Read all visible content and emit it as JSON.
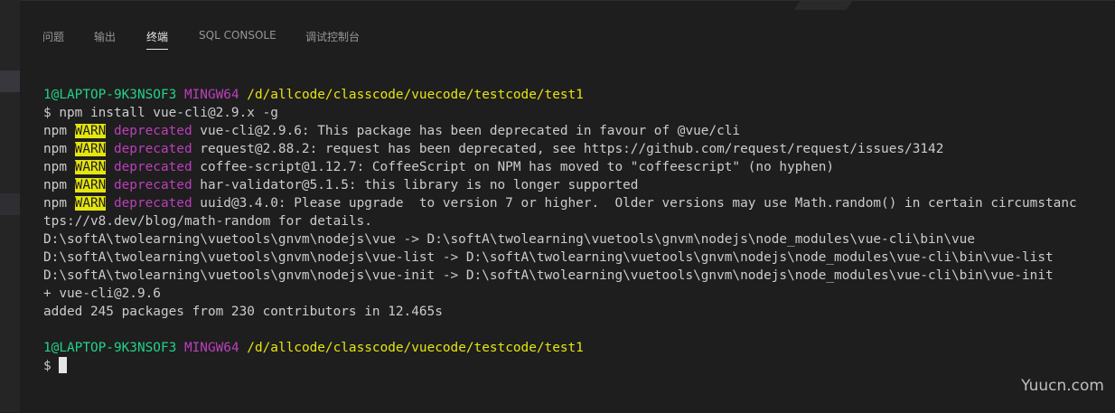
{
  "panel": {
    "tabs": [
      {
        "label": "问题",
        "active": false
      },
      {
        "label": "输出",
        "active": false
      },
      {
        "label": "终端",
        "active": true
      },
      {
        "label": "SQL CONSOLE",
        "active": false
      },
      {
        "label": "调试控制台",
        "active": false
      }
    ]
  },
  "terminal": {
    "prompt1": {
      "user": "1@LAPTOP-9K3NSOF3",
      "shell": "MINGW64",
      "path": "/d/allcode/classcode/vuecode/testcode/test1"
    },
    "command": "$ npm install vue-cli@2.9.x -g",
    "warnings": [
      {
        "prefix": "npm ",
        "level": "WARN",
        "kind": "deprecated",
        "message": " vue-cli@2.9.6: This package has been deprecated in favour of @vue/cli"
      },
      {
        "prefix": "npm ",
        "level": "WARN",
        "kind": "deprecated",
        "message": " request@2.88.2: request has been deprecated, see https://github.com/request/request/issues/3142"
      },
      {
        "prefix": "npm ",
        "level": "WARN",
        "kind": "deprecated",
        "message": " coffee-script@1.12.7: CoffeeScript on NPM has moved to \"coffeescript\" (no hyphen)"
      },
      {
        "prefix": "npm ",
        "level": "WARN",
        "kind": "deprecated",
        "message": " har-validator@5.1.5: this library is no longer supported"
      },
      {
        "prefix": "npm ",
        "level": "WARN",
        "kind": "deprecated",
        "message": " uuid@3.4.0: Please upgrade  to version 7 or higher.  Older versions may use Math.random() in certain circumstanc"
      }
    ],
    "output_lines": [
      "tps://v8.dev/blog/math-random for details.",
      "D:\\softA\\twolearning\\vuetools\\gnvm\\nodejs\\vue -> D:\\softA\\twolearning\\vuetools\\gnvm\\nodejs\\node_modules\\vue-cli\\bin\\vue",
      "D:\\softA\\twolearning\\vuetools\\gnvm\\nodejs\\vue-list -> D:\\softA\\twolearning\\vuetools\\gnvm\\nodejs\\node_modules\\vue-cli\\bin\\vue-list",
      "D:\\softA\\twolearning\\vuetools\\gnvm\\nodejs\\vue-init -> D:\\softA\\twolearning\\vuetools\\gnvm\\nodejs\\node_modules\\vue-cli\\bin\\vue-init",
      "+ vue-cli@2.9.6",
      "added 245 packages from 230 contributors in 12.465s"
    ],
    "prompt2": {
      "user": "1@LAPTOP-9K3NSOF3",
      "shell": "MINGW64",
      "path": "/d/allcode/classcode/vuecode/testcode/test1"
    },
    "input_prompt": "$ "
  },
  "watermark": "Yuucn.com"
}
